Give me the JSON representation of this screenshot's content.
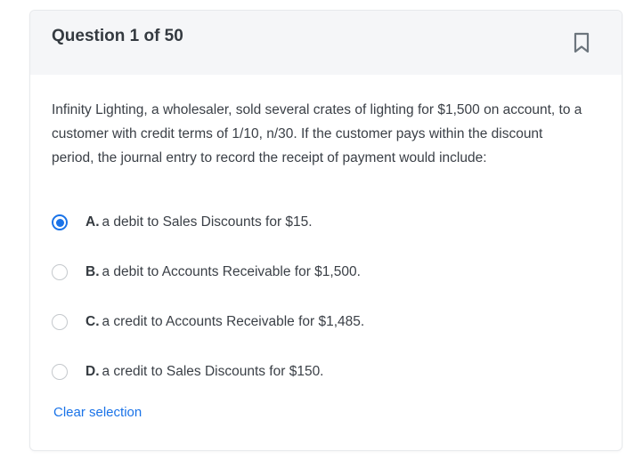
{
  "header": {
    "title": "Question 1 of 50",
    "bookmark_icon": "bookmark-icon"
  },
  "question": {
    "text": "Infinity Lighting, a wholesaler, sold several crates of lighting for $1,500 on account, to a customer with credit terms of 1/10, n/30. If the customer pays within the discount period, the journal entry to record the receipt of payment would include:"
  },
  "options": [
    {
      "letter": "A.",
      "text": "a debit to Sales Discounts for $15.",
      "selected": true
    },
    {
      "letter": "B.",
      "text": "a debit to Accounts Receivable for $1,500.",
      "selected": false
    },
    {
      "letter": "C.",
      "text": "a credit to Accounts Receivable for $1,485.",
      "selected": false
    },
    {
      "letter": "D.",
      "text": "a credit to Sales Discounts for $150.",
      "selected": false
    }
  ],
  "actions": {
    "clear_label": "Clear selection"
  },
  "colors": {
    "accent": "#1a73e8",
    "header_bg": "#f5f6f8",
    "text": "#343a40"
  }
}
